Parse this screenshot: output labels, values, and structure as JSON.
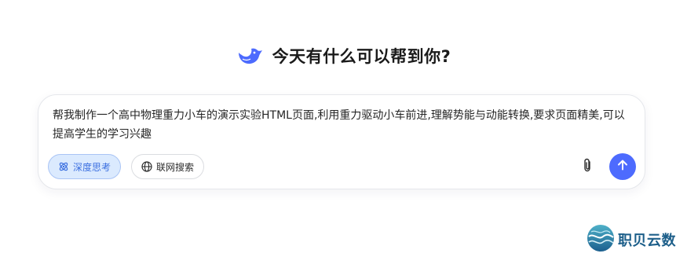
{
  "header": {
    "title": "今天有什么可以帮到你?",
    "logo_icon": "whale-logo-icon"
  },
  "composer": {
    "prompt_text": "帮我制作一个高中物理重力小车的演示实验HTML页面,利用重力驱动小车前进,理解势能与动能转换,要求页面精美,可以提高学生的学习兴趣",
    "deep_think": {
      "label": "深度思考",
      "icon": "atom-icon",
      "active": true
    },
    "web_search": {
      "label": "联网搜索",
      "icon": "globe-icon",
      "active": false
    },
    "attach_icon": "paperclip-icon",
    "send_icon": "arrow-up-icon"
  },
  "watermark": {
    "text": "职贝云数"
  },
  "colors": {
    "accent": "#4d6bfe",
    "toggle_active_bg": "#dbeafe",
    "toggle_active_text": "#3b6fe0",
    "watermark_text": "#1d5f8a"
  }
}
